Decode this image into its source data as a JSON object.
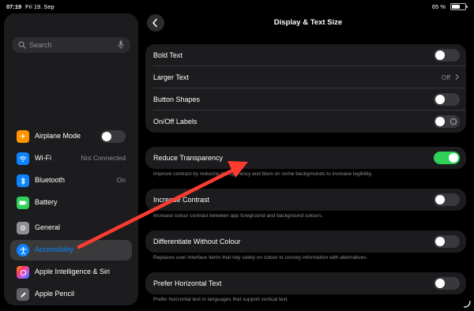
{
  "status_bar": {
    "time": "07:19",
    "date": "Fri 19. Sep",
    "battery": "65 %",
    "battery_level": 0.65
  },
  "sidebar": {
    "search_placeholder": "Search",
    "items": [
      {
        "label": "Airplane Mode",
        "value": "",
        "icon": "airplane-icon",
        "color": "#ff9500",
        "toggle": false
      },
      {
        "label": "Wi-Fi",
        "value": "Not Connected",
        "icon": "wifi-icon",
        "color": "#0a84ff"
      },
      {
        "label": "Bluetooth",
        "value": "On",
        "icon": "bluetooth-icon",
        "color": "#0a84ff"
      },
      {
        "label": "Battery",
        "value": "",
        "icon": "battery-icon",
        "color": "#30d158"
      },
      {
        "label": "General",
        "value": "",
        "icon": "gear-icon",
        "color": "#8e8e93"
      },
      {
        "label": "Accessibility",
        "value": "",
        "icon": "accessibility-icon",
        "color": "#0a84ff",
        "selected": true
      },
      {
        "label": "Apple Intelligence & Siri",
        "value": "",
        "icon": "siri-icon",
        "color": "#bf5af2"
      },
      {
        "label": "Apple Pencil",
        "value": "",
        "icon": "pencil-icon",
        "color": "#636366"
      }
    ]
  },
  "header": {
    "title": "Display & Text Size"
  },
  "groups": {
    "text": {
      "bold_text": "Bold Text",
      "larger_text": "Larger Text",
      "larger_text_value": "Off",
      "button_shapes": "Button Shapes",
      "onoff_labels": "On/Off Labels"
    },
    "reduce_transparency": {
      "label": "Reduce Transparency",
      "on": true,
      "footnote": "Improve contrast by reducing transparency and blurs on some backgrounds to increase legibility."
    },
    "increase_contrast": {
      "label": "Increase Contrast",
      "on": false,
      "footnote": "Increase colour contrast between app foreground and background colours."
    },
    "differentiate": {
      "label": "Differentiate Without Colour",
      "on": false,
      "footnote": "Replaces user interface items that rely solely on colour to convey information with alternatives."
    },
    "horizontal_text": {
      "label": "Prefer Horizontal Text",
      "on": false,
      "footnote": "Prefer horizontal text in languages that support vertical text."
    }
  },
  "colors": {
    "annotation_arrow": "#ff3b30",
    "accent": "#0a84ff",
    "toggle_on": "#30d158"
  }
}
